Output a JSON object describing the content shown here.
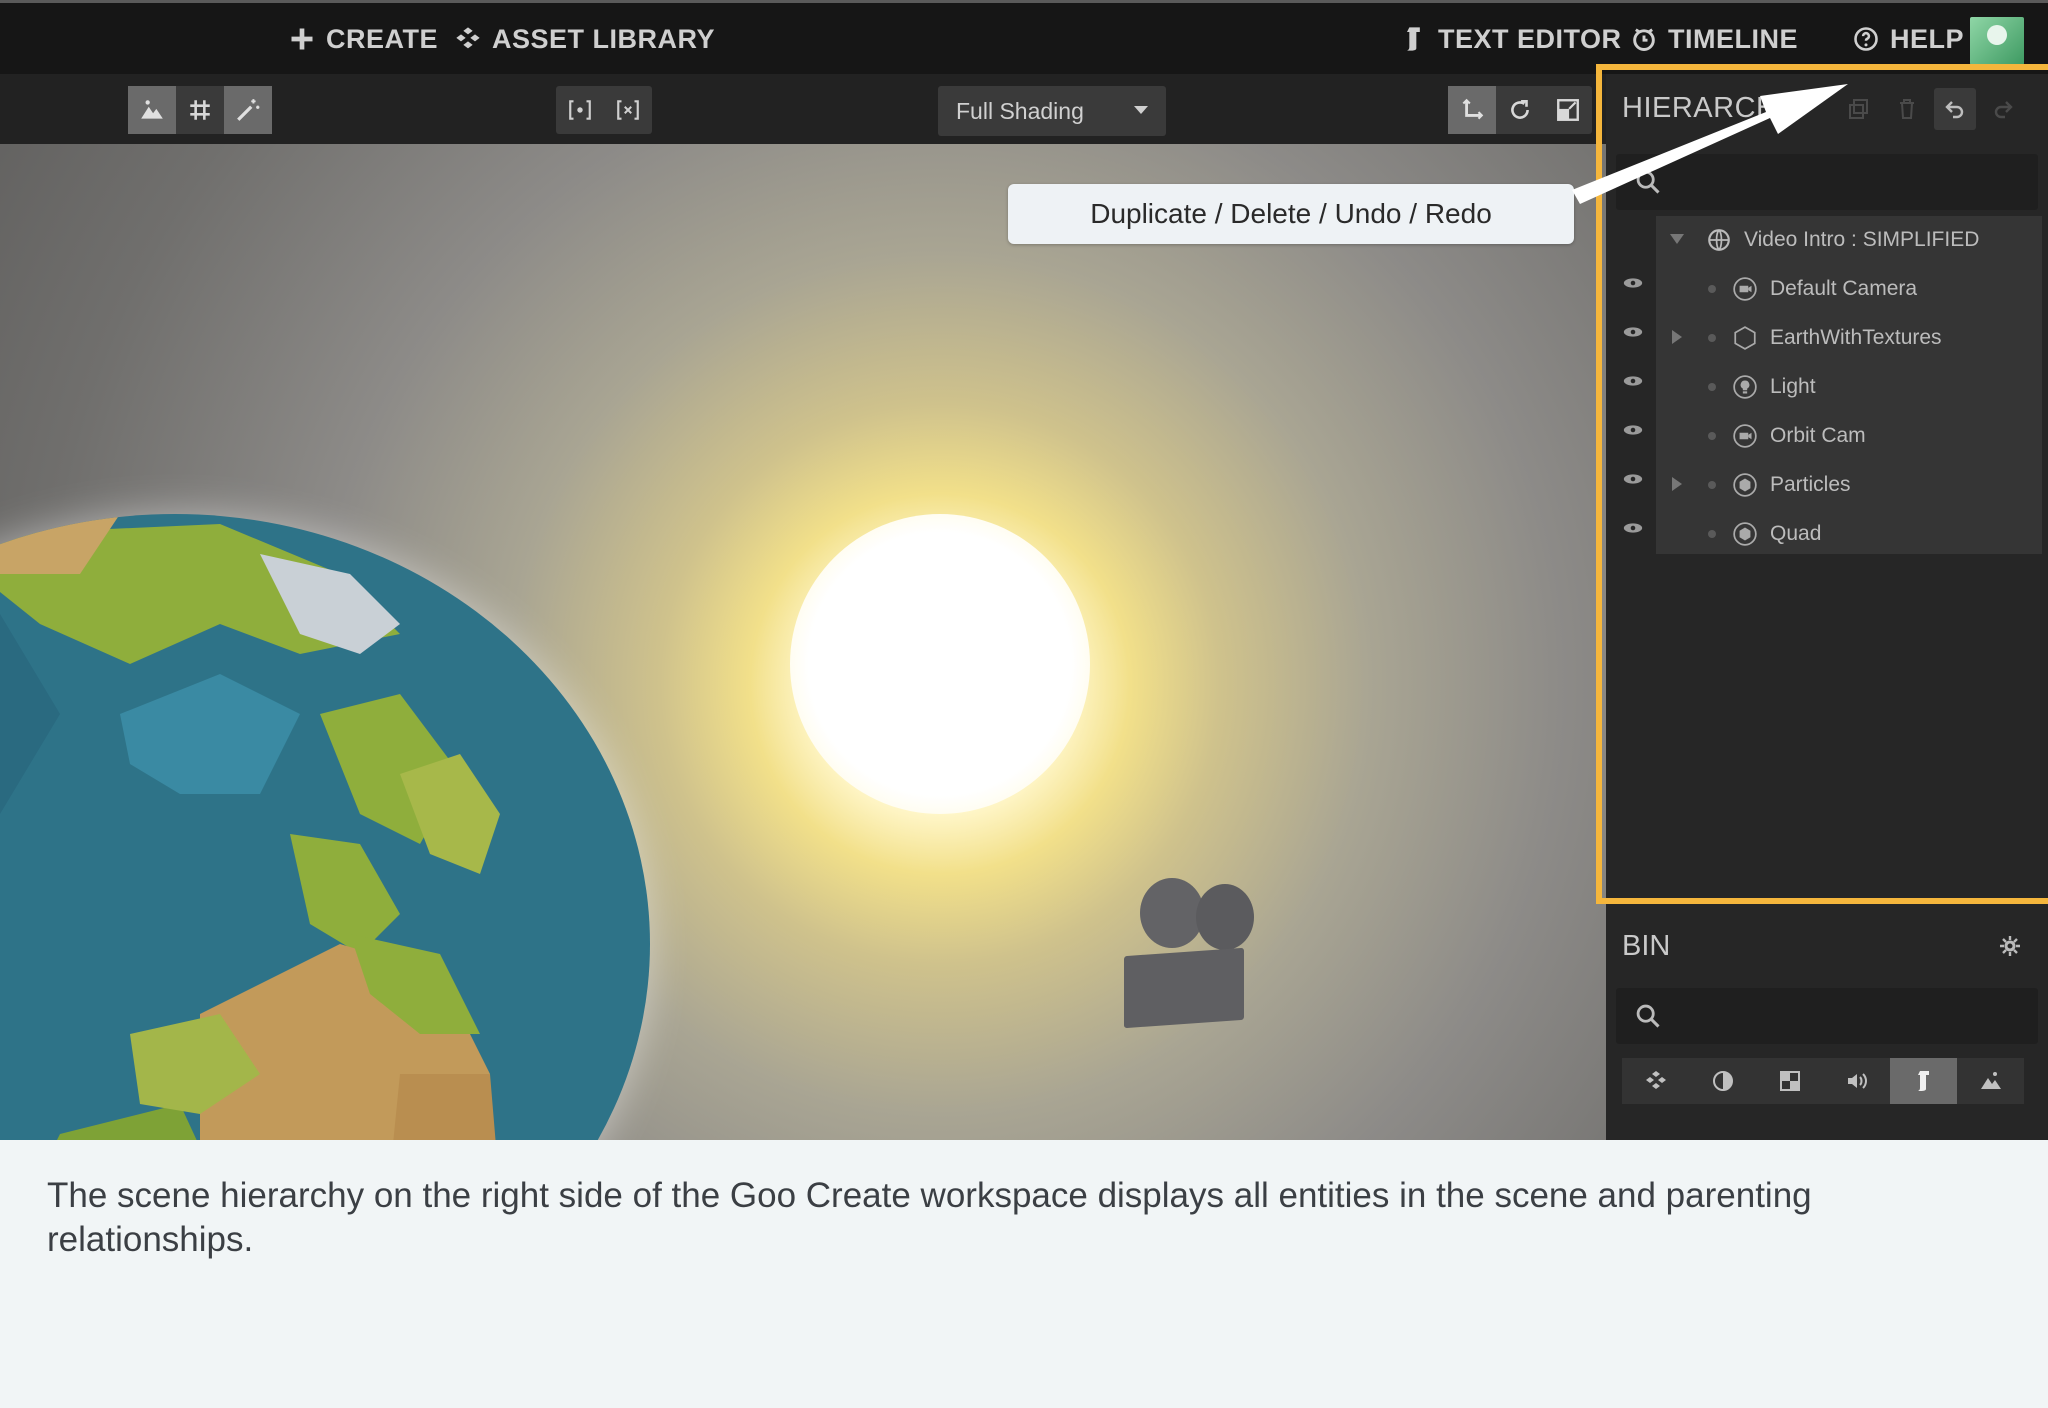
{
  "menu": {
    "create": "CREATE",
    "asset_library": "ASSET LIBRARY",
    "text_editor": "TEXT EDITOR",
    "timeline": "TIMELINE",
    "help": "HELP"
  },
  "toolbar": {
    "shading_mode": "Full Shading"
  },
  "hierarchy": {
    "title": "HIERARCHY",
    "root": "Video Intro : SIMPLIFIED",
    "entities": [
      {
        "label": "Default Camera",
        "icon": "camera-entity-icon"
      },
      {
        "label": "EarthWithTextures",
        "icon": "mesh-entity-icon"
      },
      {
        "label": "Light",
        "icon": "light-entity-icon"
      },
      {
        "label": "Orbit Cam",
        "icon": "camera-entity-icon"
      },
      {
        "label": "Particles",
        "icon": "particles-entity-icon"
      },
      {
        "label": "Quad",
        "icon": "quad-entity-icon"
      }
    ]
  },
  "bin": {
    "title": "BIN"
  },
  "callout": {
    "text": "Duplicate / Delete / Undo / Redo"
  },
  "caption": {
    "text": "The scene hierarchy on the right side of the Goo Create workspace displays all entities in the scene and parenting relationships."
  },
  "colors": {
    "highlight": "#f5b63c",
    "panel_bg": "#262626",
    "topbar_bg": "#161616"
  }
}
